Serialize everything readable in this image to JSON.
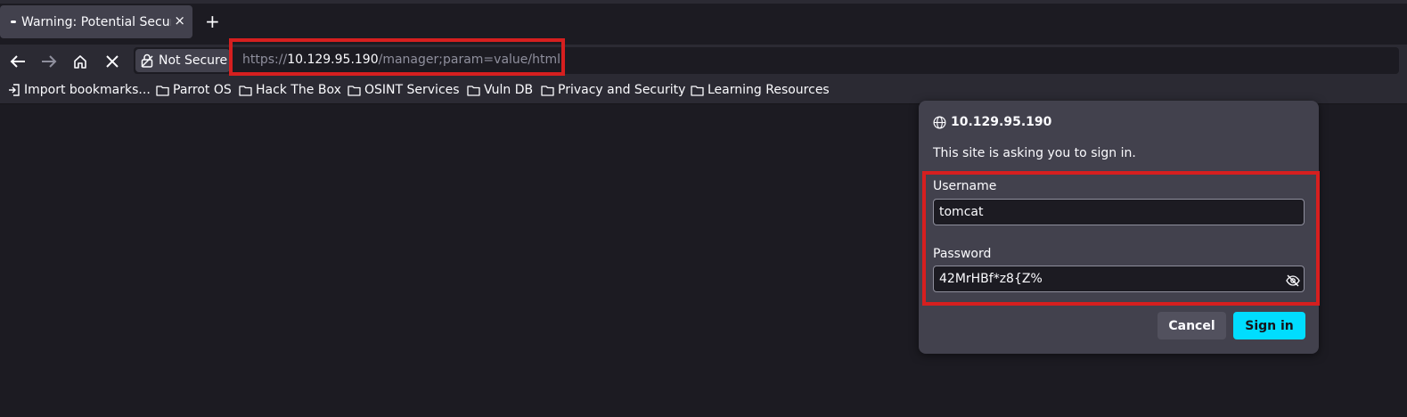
{
  "tab": {
    "title": "Warning: Potential Security Risk Ahead",
    "close": "×"
  },
  "new_tab": "+",
  "urlbar": {
    "identity_label": "Not Secure",
    "scheme": "https://",
    "host": "10.129.95.190",
    "path": "/manager;param=value/html"
  },
  "bookmarks": [
    {
      "label": "Import bookmarks...",
      "icon": "import-icon"
    },
    {
      "label": "Parrot OS",
      "icon": "folder-icon"
    },
    {
      "label": "Hack The Box",
      "icon": "folder-icon"
    },
    {
      "label": "OSINT Services",
      "icon": "folder-icon"
    },
    {
      "label": "Vuln DB",
      "icon": "folder-icon"
    },
    {
      "label": "Privacy and Security",
      "icon": "folder-icon"
    },
    {
      "label": "Learning Resources",
      "icon": "folder-icon"
    }
  ],
  "auth_dialog": {
    "host": "10.129.95.190",
    "message": "This site is asking you to sign in.",
    "username_label": "Username",
    "username_value": "tomcat",
    "password_label": "Password",
    "password_value": "42MrHBf*z8{Z%",
    "cancel_label": "Cancel",
    "signin_label": "Sign in"
  },
  "colors": {
    "background": "#1c1b22",
    "toolbar": "#2b2a33",
    "dialog": "#42414d",
    "accent": "#00ddff",
    "highlight": "#d61f1f"
  }
}
